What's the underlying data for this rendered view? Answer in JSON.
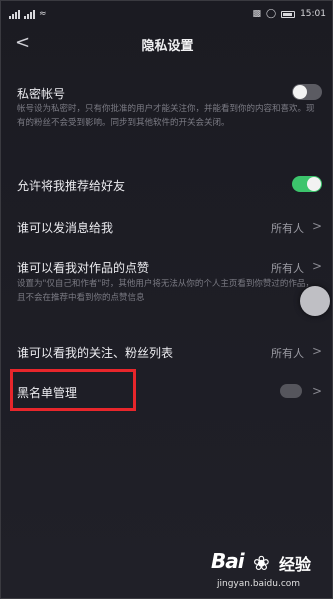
{
  "status_bar": {
    "time": "15:01"
  },
  "nav": {
    "back_glyph": "<",
    "title": "隐私设置"
  },
  "private_account": {
    "label": "私密帐号",
    "description": "帐号设为私密时，只有你批准的用户才能关注你，并能看到你的内容和喜欢。现有的粉丝不会受到影响。同步到其他软件的开关会关闭。",
    "toggle_on": false
  },
  "recommend_to_friends": {
    "label": "允许将我推荐给好友",
    "toggle_on": true
  },
  "who_can_message": {
    "label": "谁可以发消息给我",
    "value": "所有人"
  },
  "who_can_see_likes": {
    "label": "谁可以看我对作品的点赞",
    "value": "所有人",
    "description": "设置为\"仅自己和作者\"时，其他用户将无法从你的个人主页看到你赞过的作品，且不会在推荐中看到你的点赞信息"
  },
  "who_can_see_follows": {
    "label": "谁可以看我的关注、粉丝列表",
    "value": "所有人"
  },
  "blacklist": {
    "label": "黑名单管理"
  },
  "chevron_glyph": ">",
  "watermark": {
    "logo": "Bai",
    "logo_suffix": "经验",
    "url": "jingyan.baidu.com"
  },
  "colors": {
    "background": "#1d1d24",
    "toggle_on": "#3cc46c",
    "toggle_off": "#5b5b62",
    "highlight_box": "#e8262b"
  }
}
